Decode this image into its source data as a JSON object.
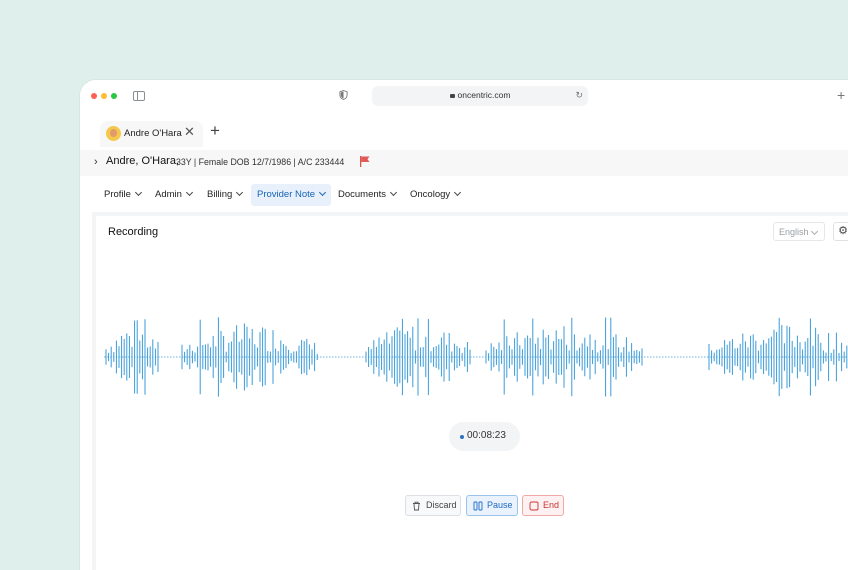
{
  "browser": {
    "url": "oncentric.com"
  },
  "tab": {
    "label": "Andre O'Hara"
  },
  "patient": {
    "name": "Andre, O'Hara,",
    "info": "33Y | Female DOB 12/7/1986 | A/C 233444"
  },
  "nav": {
    "items": [
      {
        "label": "Profile"
      },
      {
        "label": "Admin"
      },
      {
        "label": "Billing"
      },
      {
        "label": "Provider Note"
      },
      {
        "label": "Documents"
      },
      {
        "label": "Oncology"
      }
    ],
    "active": "Provider Note"
  },
  "recording": {
    "title": "Recording",
    "language": "English",
    "elapsed": "00:08:23",
    "discard_label": "Discard",
    "pause_label": "Pause",
    "end_label": "End"
  },
  "colors": {
    "accent": "#1764b6",
    "wave": "#3a9bd9",
    "end": "#cc3333",
    "background": "#dff0ec"
  },
  "icons": [
    "shield-icon",
    "lock-icon",
    "reload-icon",
    "add-window-icon",
    "close-icon",
    "add-tab-icon",
    "chevron-right-icon",
    "flag-icon",
    "gear-icon",
    "trash-icon",
    "pause-icon",
    "stop-icon"
  ]
}
